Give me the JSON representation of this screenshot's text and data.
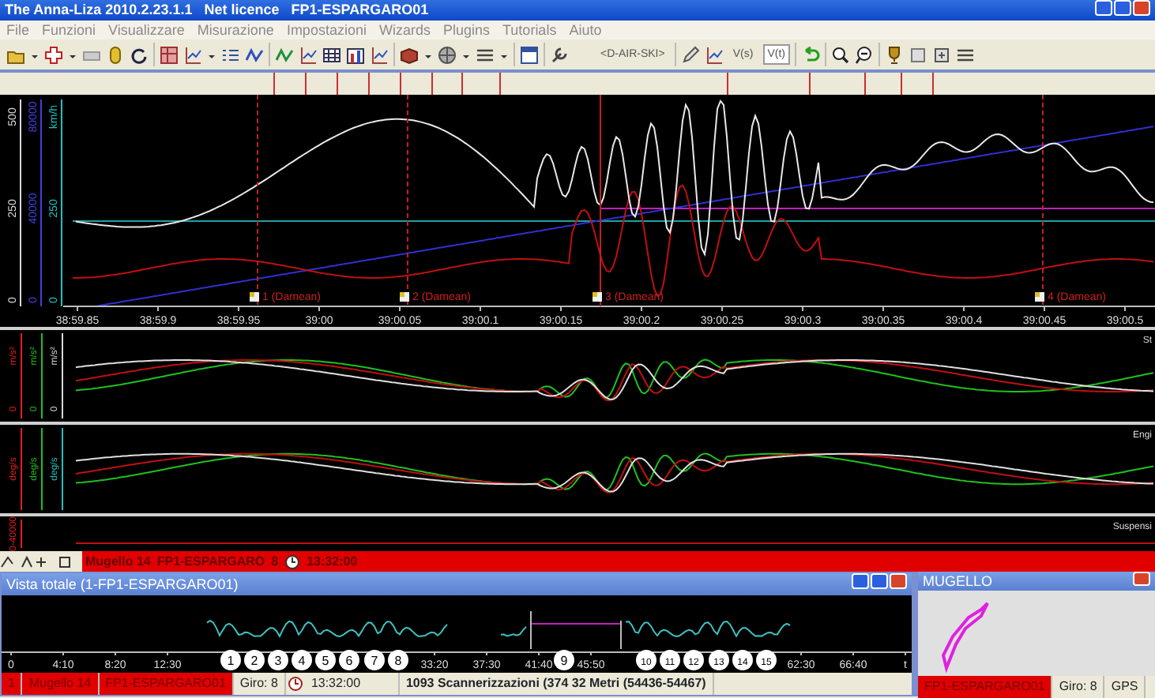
{
  "window": {
    "title": "The Anna-Liza 2010.2.23.1.1   Net licence   FP1-ESPARGARO01"
  },
  "menu": [
    "File",
    "Funzioni",
    "Visualizzare",
    "Misurazione",
    "Impostazioni",
    "Wizards",
    "Plugins",
    "Tutorials",
    "Aiuto"
  ],
  "toolbar": {
    "text_buttons": [
      {
        "label": "<D-AIR-SKI>",
        "selected": false
      },
      {
        "label": "V(s)",
        "selected": false
      },
      {
        "label": "V(t)",
        "selected": true
      }
    ]
  },
  "main_chart": {
    "axes": [
      {
        "color": "#d8d8d8",
        "labels": [
          "0",
          "250",
          "500"
        ]
      },
      {
        "color": "#4040e0",
        "labels": [
          "0",
          "40000",
          "80000"
        ]
      },
      {
        "color": "#20c0c0",
        "labels": [
          "0",
          "250",
          "km/h"
        ]
      }
    ],
    "time_labels": [
      "38:59.85",
      "38:59.9",
      "38:59.95",
      "39:00",
      "39:00.05",
      "39:00.1",
      "39:00.15",
      "39:00.2",
      "39:00.25",
      "39:00.3",
      "39:00.35",
      "39:00.4",
      "39:00.45",
      "39:00.5"
    ],
    "markers": [
      "1 (Damean)",
      "2 (Damean)",
      "3 (Damean)",
      "4 (Damean)"
    ]
  },
  "panels": [
    {
      "title": "St",
      "axes": [
        {
          "color": "#e02020",
          "labels": [
            "0",
            "m/s²"
          ]
        },
        {
          "color": "#20c020",
          "labels": [
            "0",
            "m/s²"
          ]
        },
        {
          "color": "#d8d8d8",
          "labels": [
            "0",
            "m/s²"
          ]
        }
      ]
    },
    {
      "title": "Engi",
      "axes": [
        {
          "color": "#e02020",
          "labels": [
            "deg/s"
          ]
        },
        {
          "color": "#20c020",
          "labels": [
            "deg/s"
          ]
        },
        {
          "color": "#20c0c0",
          "labels": [
            "deg/s"
          ]
        }
      ]
    },
    {
      "title": "Suspensi",
      "axes": [
        {
          "color": "#e02020",
          "labels": [
            "0-40000"
          ]
        }
      ]
    }
  ],
  "status_strip": {
    "circuit": "Mugello 14",
    "session": "FP1-ESPARGARO",
    "lap": "8",
    "time": "13:32:00"
  },
  "overview": {
    "title": "Vista totale (1-FP1-ESPARGARO01)",
    "time_label_groups": [
      [
        "0",
        "4:10",
        "8:20",
        "12:30"
      ],
      [
        "33:20",
        "37:30",
        "41:40",
        "45:50"
      ],
      [
        "62:30",
        "66:40",
        "t"
      ]
    ],
    "laps": [
      "1",
      "2",
      "3",
      "4",
      "5",
      "6",
      "7",
      "8",
      "9",
      "10",
      "11",
      "12",
      "13",
      "14",
      "15"
    ],
    "status": {
      "index": "1",
      "circuit": "Mugello 14",
      "session": "FP1-ESPARGARO01",
      "lap": "Giro: 8",
      "time": "13:32:00",
      "scans": "1093 Scannerizzazioni (374 32 Metri (54436-54467)"
    }
  },
  "track_map": {
    "title": "MUGELLO",
    "session": "FP1-ESPARGARO01",
    "lap": "Giro: 8",
    "source": "GPS"
  }
}
